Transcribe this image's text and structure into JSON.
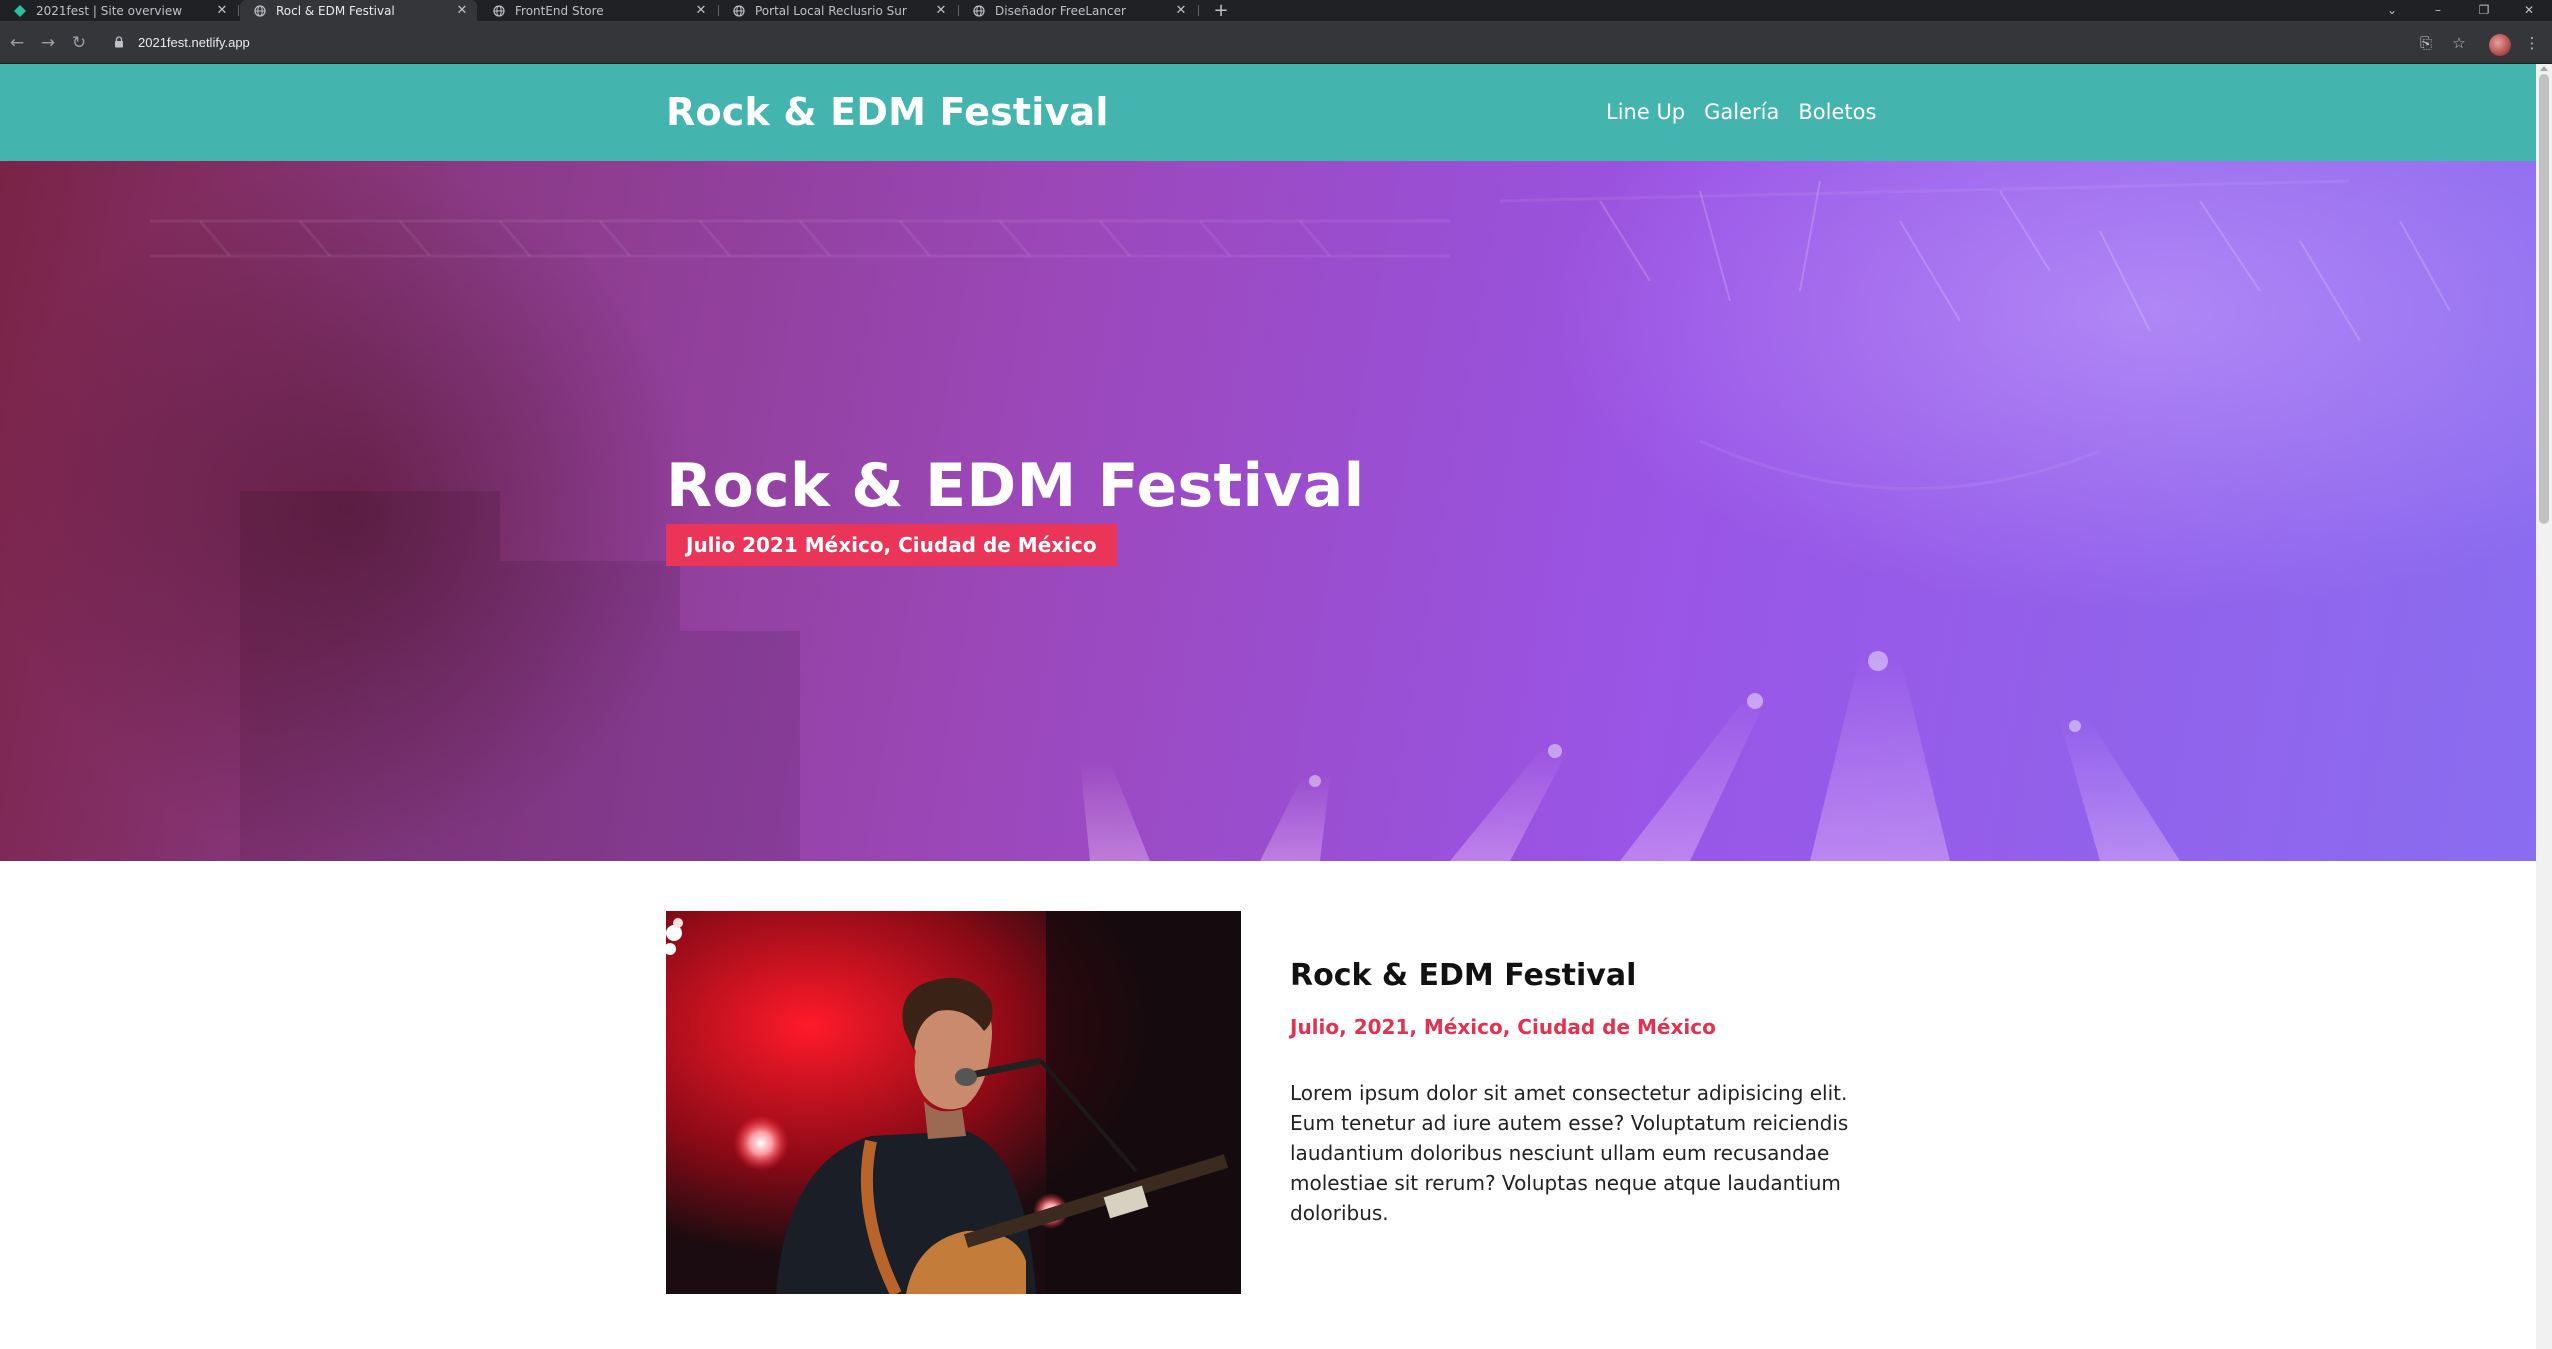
{
  "browser": {
    "tabs": [
      {
        "title": "2021fest | Site overview",
        "favicon": "netlify-icon"
      },
      {
        "title": "Rocl & EDM Festival",
        "favicon": "globe-icon",
        "active": true
      },
      {
        "title": "FrontEnd Store",
        "favicon": "globe-icon"
      },
      {
        "title": "Portal Local Reclusrio Sur",
        "favicon": "globe-icon"
      },
      {
        "title": "Diseñador FreeLancer",
        "favicon": "globe-icon"
      }
    ],
    "url": "2021fest.netlify.app"
  },
  "site": {
    "logo": "Rock & EDM Festival",
    "nav": [
      "Line Up",
      "Galería",
      "Boletos"
    ],
    "colors": {
      "header": "#44b5ae",
      "accent": "#ea3558"
    }
  },
  "hero": {
    "title": "Rock & EDM Festival",
    "badge": "Julio 2021 México, Ciudad de México"
  },
  "about": {
    "title": "Rock & EDM Festival",
    "date": "Julio, 2021, México, Ciudad de México",
    "text": "Lorem ipsum dolor sit amet consectetur adipisicing elit. Eum tenetur ad iure autem esse? Voluptatum reiciendis laudantium doloribus nesciunt ullam eum recusandae molestiae sit rerum? Voluptas neque atque laudantium doloribus."
  }
}
